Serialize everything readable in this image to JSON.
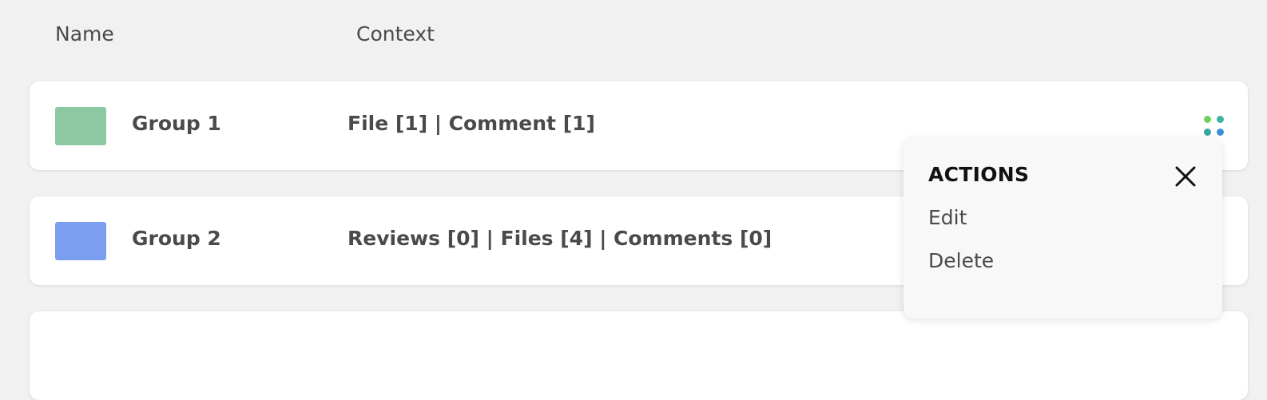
{
  "table": {
    "headers": {
      "name": "Name",
      "context": "Context"
    },
    "rows": [
      {
        "name": "Group 1",
        "context": "File [1] | Comment [1]",
        "swatch_color": "#8dc9a0"
      },
      {
        "name": "Group 2",
        "context": "Reviews [0] | Files [4] | Comments [0]",
        "swatch_color": "#7a9ff0"
      }
    ]
  },
  "kebab_menu": {
    "icon": "four-dots-icon",
    "dot_colors": [
      "#6fd15a",
      "#3fb2a3",
      "#35a6a0",
      "#3a8fd6"
    ]
  },
  "actions_menu": {
    "title": "ACTIONS",
    "close_icon": "close-icon",
    "items": [
      {
        "label": "Edit"
      },
      {
        "label": "Delete"
      }
    ]
  }
}
